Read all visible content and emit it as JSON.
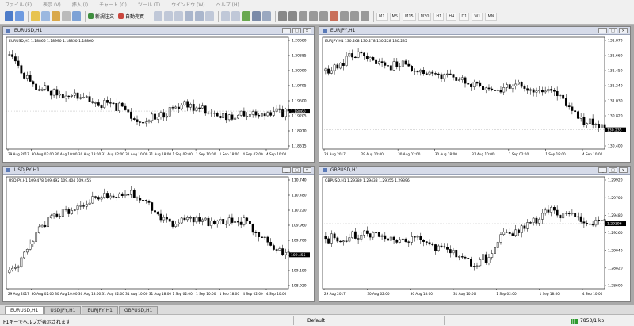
{
  "menu": {
    "items": [
      "ファイル (F)",
      "表示 (V)",
      "挿入 (I)",
      "チャート (C)",
      "ツール (T)",
      "ウインドウ (W)",
      "ヘルプ (H)"
    ]
  },
  "toolbar": {
    "new_order_label": "新規注文",
    "autotrade_label": "自動売買",
    "timeframes": [
      "M1",
      "M5",
      "M15",
      "M30",
      "H1",
      "H4",
      "D1",
      "W1",
      "MN"
    ]
  },
  "charts": [
    {
      "id": "EURUSD",
      "title": "EURUSD,H1",
      "info": "EURUSD,H1  1.18866 1.18990 1.18850 1.18860",
      "ylim": [
        1.186,
        1.2068
      ],
      "price_ticks": [
        "1.20680",
        "1.20385",
        "1.20090",
        "1.19795",
        "1.19500",
        "1.19205",
        "1.18910",
        "1.18615"
      ],
      "current_price": "1.18860",
      "time_ticks": [
        "29 Aug 2017",
        "30 Aug 02:00",
        "30 Aug 10:00",
        "30 Aug 18:00",
        "31 Aug 02:00",
        "31 Aug 10:00",
        "31 Aug 18:00",
        "1 Sep 02:00",
        "1 Sep 10:00",
        "1 Sep 18:00",
        "4 Sep 02:00",
        "4 Sep 10:00"
      ],
      "candle_path": [
        0.15,
        0.34,
        0.46,
        0.49,
        0.52,
        0.55,
        0.6,
        0.62,
        0.67,
        0.8,
        0.74,
        0.66,
        0.62,
        0.66,
        0.73,
        0.72,
        0.7,
        0.72,
        0.69,
        0.68
      ]
    },
    {
      "id": "EURJPY",
      "title": "EURJPY,H1",
      "info": "EURJPY,H1  130.268 130.278 130.228 130.235",
      "ylim": [
        130.2,
        131.9
      ],
      "price_ticks": [
        "131.870",
        "131.660",
        "131.450",
        "131.240",
        "131.030",
        "130.820",
        "130.610",
        "130.400"
      ],
      "current_price": "130.235",
      "time_ticks": [
        "28 Aug 2017",
        "29 Aug 10:00",
        "30 Aug 02:00",
        "30 Aug 18:00",
        "31 Aug 10:00",
        "1 Sep 02:00",
        "1 Sep 18:00",
        "4 Sep 10:00"
      ],
      "candle_path": [
        0.3,
        0.22,
        0.12,
        0.18,
        0.25,
        0.22,
        0.28,
        0.3,
        0.34,
        0.38,
        0.42,
        0.48,
        0.46,
        0.42,
        0.52,
        0.45,
        0.55,
        0.72,
        0.8,
        0.86
      ]
    },
    {
      "id": "USDJPY",
      "title": "USDJPY,H1",
      "info": "USDJPY,H1  109.478 109.492 109.404 109.455",
      "ylim": [
        108.9,
        110.9
      ],
      "price_ticks": [
        "110.740",
        "110.480",
        "110.220",
        "109.960",
        "109.700",
        "109.440",
        "109.180",
        "108.920"
      ],
      "current_price": "109.455",
      "time_ticks": [
        "29 Aug 2017",
        "30 Aug 02:00",
        "30 Aug 10:00",
        "30 Aug 18:00",
        "31 Aug 02:00",
        "31 Aug 10:00",
        "31 Aug 18:00",
        "1 Sep 02:00",
        "1 Sep 10:00",
        "1 Sep 18:00",
        "4 Sep 02:00",
        "4 Sep 10:00"
      ],
      "candle_path": [
        0.9,
        0.72,
        0.45,
        0.35,
        0.3,
        0.24,
        0.18,
        0.14,
        0.13,
        0.18,
        0.32,
        0.42,
        0.38,
        0.4,
        0.42,
        0.4,
        0.38,
        0.56,
        0.64,
        0.72
      ]
    },
    {
      "id": "GBPUSD",
      "title": "GBPUSD,H1",
      "info": "GBPUSD,H1  1.29380 1.29438 1.29355 1.29396",
      "ylim": [
        1.2848,
        1.3003
      ],
      "price_ticks": [
        "1.29920",
        "1.29700",
        "1.29480",
        "1.29260",
        "1.29040",
        "1.28820",
        "1.28600"
      ],
      "current_price": "1.29396",
      "time_ticks": [
        "29 Aug 2017",
        "30 Aug 02:00",
        "30 Aug 18:00",
        "31 Aug 10:00",
        "1 Sep 02:00",
        "1 Sep 18:00",
        "4 Sep 10:00"
      ],
      "candle_path": [
        0.55,
        0.58,
        0.54,
        0.52,
        0.56,
        0.58,
        0.55,
        0.62,
        0.66,
        0.72,
        0.82,
        0.74,
        0.55,
        0.48,
        0.42,
        0.28,
        0.32,
        0.35,
        0.38,
        0.42
      ]
    }
  ],
  "symbol_tabs": [
    "EURUSD,H1",
    "USDJPY,H1",
    "EURJPY,H1",
    "GBPUSD,H1"
  ],
  "status": {
    "help": "F1キーでヘルプが表示されます",
    "profile": "Default",
    "traffic": "7853/1 kb"
  },
  "window_controls": [
    "_",
    "□",
    "×"
  ]
}
